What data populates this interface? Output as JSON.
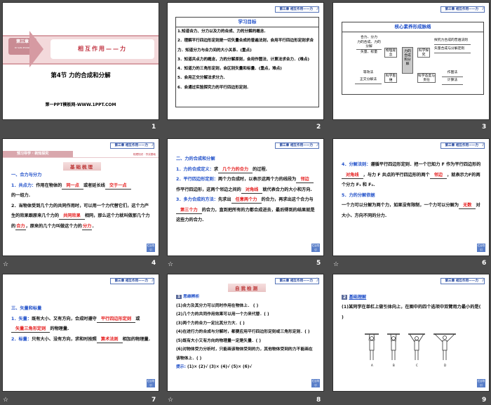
{
  "header_tag": "第三章  相互作用——力",
  "nav_button": "栏目导引",
  "star": "☆",
  "slides": [
    {
      "number": "1",
      "chapter": "第三章",
      "chapter_pinyin": "DI SAN ZHANG",
      "title": "相互作用——力",
      "section": "第4节  力的合成和分解",
      "footer": "第一PPT模板网-WWW.1PPT.COM"
    },
    {
      "number": "2",
      "heading": "学习目标",
      "items": [
        "1.知道合力、分力以及力的合成、力的分解的概念.",
        "2．理解平行四边形定则是一切矢量合成的普遍法则，会用平行四边形定则求合力．知道分力与合力间的大小关系．(重点)",
        "3．知道共点力的概念，力的分解原则，会用作图法、计算法求合力．(难点)",
        "4．知道力的三角形定则，会区别矢量和标量．(重点，难点)",
        "5．会用正交分解法求分力.",
        "6．会通过实验探究力的平行四边形定则."
      ]
    },
    {
      "number": "3",
      "heading": "核心素养形成脉络",
      "center": "力的合成和分解",
      "left_top_nodes": [
        "合力、分力",
        "力的合成、力的分解",
        "矢量、标量"
      ],
      "left_top_hub": "物理观念",
      "left_bottom_nodes": [
        "等效法",
        "正交分解法"
      ],
      "left_bottom_hub": "科学思维",
      "right_top_hub": "科学探究",
      "right_top_nodes": [
        "探究力合成的普遍法则",
        "矢量合成与分解定则"
      ],
      "right_bottom_hub": "科学态度与责任",
      "right_bottom_nodes": [
        "作图法",
        "计算法"
      ]
    },
    {
      "number": "4",
      "banner": "预习导学 · 新知探究",
      "banner_right": "梳理知识 · 夯实基础",
      "pill": "基础梳理",
      "h1": "一、合力与分力",
      "p1_label": "1．共点力：",
      "p1_a": "作用在物体的",
      "b1": "同一点",
      "p1_b": "或者延长线",
      "b2": "交于一点",
      "p1_c": "的一组力.",
      "p2_a": "2．当物体受到几个力的共同作用时，可以用一个力代替它们，这个力产生的效果跟原来几个力的",
      "b3": "共同效果",
      "p2_b": "相同，那么这个力就叫做那几个力的",
      "b4": "合力",
      "p2_c": "，原来的几个力叫做这个力的",
      "b5": "分力",
      "p2_d": "."
    },
    {
      "number": "5",
      "h1": "二、力的合成和分解",
      "l1": "1．力的合成定义：",
      "t1a": "求",
      "b1": "几个力的合力",
      "t1b": "的过程.",
      "l2": "2．平行四边形定则：",
      "t2a": "两个力合成时，以表示这两个力的线段为",
      "b2": "邻边",
      "t2b": "作平行四边形，这两个邻边之间的",
      "b3": "对角线",
      "t2c": "就代表合力的大小和方向.",
      "l3": "3．多力合成的方法：",
      "t3a": "先求出",
      "b4": "任意两个力",
      "t3b": "的合力，再求出这个合力与",
      "b5": "第三个力",
      "t3c": "的合力，直到把所有的力都合成进去，最后得到的结果就是这些力的合力."
    },
    {
      "number": "6",
      "l4": "4．分解法则：",
      "t4a": "遵循平行四边形定则．把一个已知力 F 作为平行四边形的",
      "b1": "对角线",
      "t4b": "，与力 F 共点的平行四边形的两个",
      "b2": "邻边",
      "t4c": "，就表示力F的两个分力 F₁ 和 F₂.",
      "l5": "5．力的分解依据",
      "t5a": "一个力可以分解为两个力，如果没有限制，一个力可以分解为",
      "b3": "无数",
      "t5b": "对大小、方向不同的分力."
    },
    {
      "number": "7",
      "h1": "三、矢量和标量",
      "l1": "1．矢量：",
      "t1a": "既有大小、又有方向，合成时遵守",
      "b1": "平行四边形定则",
      "t1b": "或",
      "b2": "矢量三角形定则",
      "t1c": "的物理量.",
      "l2": "2．标量：",
      "t2a": "只有大小、没有方向，求和时按照",
      "b3": "算术法则",
      "t2b": "相加的物理量."
    },
    {
      "number": "8",
      "pill": "自我检测",
      "sub_num": "1",
      "sub": "思维辨析",
      "items": [
        "(1)合力及其分力可以同时作用在物体上．  (    )",
        "(2)几个力的共同作用效果可以用一个力来代替．(    )",
        "(3)两个力的合力一定比其分力大．(    )",
        "(4)在进行力的合成与分解时，都要应用平行四边形定则或三角形定则．(    )",
        "(5)既有大小又有方向的物理量一定是矢量．(    )",
        "(6)对物体受力分析时，只能画该物体受到的力，其他物体受到的力不能画在该物体上．(    )"
      ],
      "hint_label": "提示:",
      "hint": "(1)×  (2)√  (3)×  (4)√  (5)×  (6)√"
    },
    {
      "number": "9",
      "sub_num": "2",
      "sub": "基础理解",
      "question": "(1)某同学在单杠上做引体向上，在图中的四个选项中双臂用力最小的是(     )",
      "options": [
        "A",
        "B",
        "C",
        "D"
      ]
    }
  ]
}
